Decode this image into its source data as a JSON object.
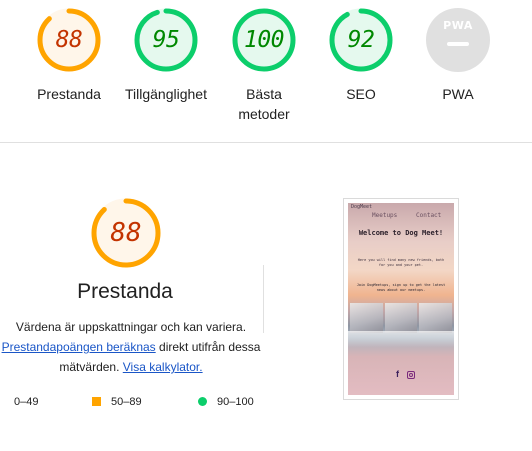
{
  "scores": [
    {
      "key": "performance",
      "value": "88",
      "label": "Prestanda",
      "status": "average",
      "fraction": 0.88
    },
    {
      "key": "accessibility",
      "value": "95",
      "label": "Tillgänglighet",
      "status": "pass",
      "fraction": 0.95
    },
    {
      "key": "best-practices",
      "value": "100",
      "label": "Bästa metoder",
      "status": "pass",
      "fraction": 1.0
    },
    {
      "key": "seo",
      "value": "92",
      "label": "SEO",
      "status": "pass",
      "fraction": 0.92
    },
    {
      "key": "pwa",
      "value": "",
      "label": "PWA",
      "status": "na",
      "badge": "PWA"
    }
  ],
  "performance_detail": {
    "value": "88",
    "fraction": 0.88,
    "title": "Prestanda",
    "desc_line1": "Värdena är uppskattningar och kan variera.",
    "link_calc": "Prestandapoängen beräknas",
    "desc_mid": "direkt utifrån dessa",
    "desc_end": "mätvärden.",
    "link_calculator": "Visa kalkylator."
  },
  "legend": {
    "fail": "0–49",
    "average": "50–89",
    "pass": "90–100"
  },
  "preview": {
    "brand": "DogMeet",
    "nav_meetups": "Meetups",
    "nav_contact": "Contact",
    "title": "Welcome to Dog Meet!",
    "text1": "Here you will find many new friends, both for you and your pet.",
    "text2": "Join DogMeetups, sign up to get the latest news about our meetups."
  },
  "colors": {
    "pass": "#0cce6b",
    "pass_text": "#008800",
    "pass_bg": "#e5f9ee",
    "average": "#ffa400",
    "average_text": "#c33300",
    "average_bg": "#fff6ea",
    "na": "#e0e0e0",
    "link": "#1a56c7"
  }
}
